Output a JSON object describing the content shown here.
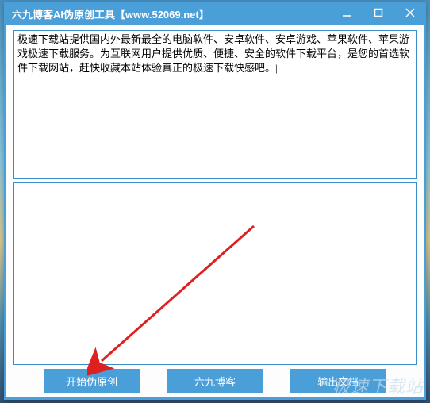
{
  "window": {
    "title": "六九博客AI伪原创工具【www.52069.net】"
  },
  "input": {
    "value": "极速下载站提供国内外最新最全的电脑软件、安卓软件、安卓游戏、苹果软件、苹果游戏极速下载服务。为互联网用户提供优质、便捷、安全的软件下载平台，是您的首选软件下载网站，赶快收藏本站体验真正的极速下载快感吧。|"
  },
  "output": {
    "value": ""
  },
  "buttons": {
    "start": "开始伪原创",
    "blog": "六九博客",
    "export": "输出文档"
  },
  "watermark": "极速下载站"
}
